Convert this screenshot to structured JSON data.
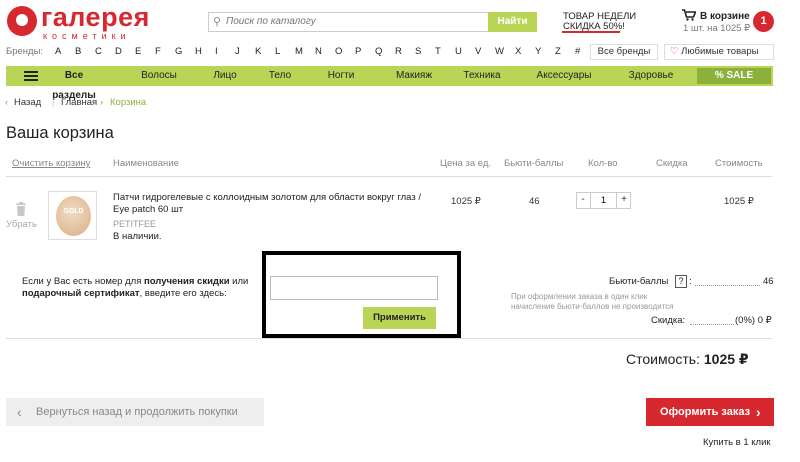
{
  "header": {
    "logo_name": "галерея",
    "logo_sub": "косметики",
    "search_placeholder": "Поиск по каталогу",
    "search_button": "Найти",
    "promo_line1": "ТОВАР НЕДЕЛИ",
    "promo_line2": "СКИДКА 50%!",
    "cart_title": "В корзине",
    "cart_sub": "1 шт. на 1025 ₽",
    "cart_count": "1"
  },
  "brands": {
    "label": "Бренды:",
    "letters": [
      "A",
      "B",
      "C",
      "D",
      "E",
      "F",
      "G",
      "H",
      "I",
      "J",
      "K",
      "L",
      "M",
      "N",
      "O",
      "P",
      "Q",
      "R",
      "S",
      "T",
      "U",
      "V",
      "W",
      "X",
      "Y",
      "Z",
      "#"
    ],
    "all_brands": "Все бренды",
    "favorites": "Любимые товары"
  },
  "menu": {
    "items": [
      "Все разделы",
      "Волосы",
      "Лицо",
      "Тело",
      "Ногти",
      "Макияж",
      "Техника",
      "Аксессуары",
      "Здоровье"
    ],
    "sale": "% SALE"
  },
  "breadcrumb": {
    "back": "Назад",
    "home": "Главная",
    "current": "Корзина"
  },
  "page_title": "Ваша корзина",
  "table": {
    "clear": "Очистить корзину",
    "name": "Наименование",
    "price": "Цена за ед.",
    "beauty_points": "Бьюти-баллы",
    "qty": "Кол-во",
    "discount": "Скидка",
    "cost": "Стоимость"
  },
  "item": {
    "remove": "Убрать",
    "thumb_label": "GOLD",
    "name": "Патчи гидрогелевые с коллоидным золотом для области вокруг глаз / Eye patch 60 шт",
    "brand": "PETITFEE",
    "stock": "В наличии.",
    "price": "1025 ₽",
    "beauty_points": "46",
    "qty": "1",
    "minus": "-",
    "plus": "+",
    "cost": "1025 ₽"
  },
  "coupon": {
    "text_1": "Если у Вас есть номер для ",
    "text_2": "получения скидки",
    "text_3": " или ",
    "text_4": "подарочный сертификат",
    "text_5": ", введите его здесь:",
    "apply": "Применить",
    "value": ""
  },
  "totals": {
    "beauty_label": "Бьюти-баллы",
    "beauty_help": "?",
    "beauty_colon": ":",
    "beauty_value": "46",
    "note": "При оформлении заказа в один клик начисление бьюти-баллов не производится",
    "discount_label": "Скидка:",
    "discount_value": "(0%) 0 ₽",
    "total_label": "Стоимость:",
    "total_value": "1025 ₽"
  },
  "footer": {
    "back": "Вернуться назад и продолжить покупки",
    "order": "Оформить заказ",
    "one_click": "Купить в 1 клик"
  },
  "colors": {
    "brand_red": "#d7282f",
    "accent_green": "#b9d556"
  }
}
